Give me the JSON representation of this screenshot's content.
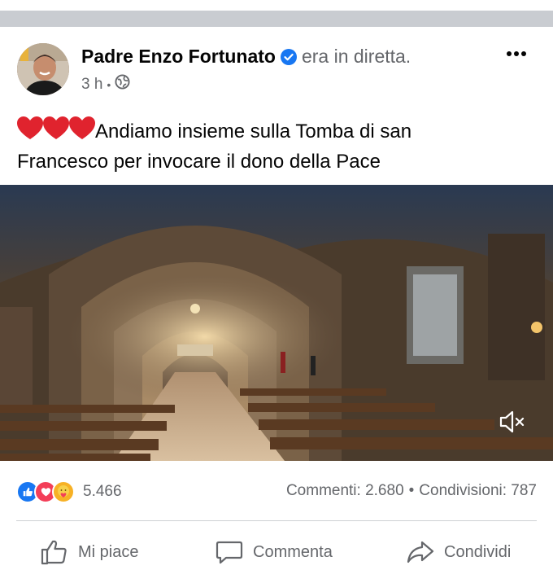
{
  "post": {
    "author_name": "Padre Enzo Fortunato",
    "live_status": "era in diretta.",
    "time_ago": "3 h",
    "meta_dot": "•",
    "text_line1": "Andiamo insieme sulla Tomba di san",
    "text_line2": "Francesco per invocare il dono della Pace",
    "emoji_prefix": "❤❤❤"
  },
  "engagement": {
    "reaction_count": "5.466",
    "comments": "Commenti: 2.680",
    "separator": "•",
    "shares": "Condivisioni: 787"
  },
  "actions": {
    "like": "Mi piace",
    "comment": "Commenta",
    "share": "Condividi"
  },
  "colors": {
    "verified": "#1877f2",
    "like_blue": "#1877f2",
    "love_red": "#f33e58",
    "care_yellow": "#f7b125",
    "secondary_text": "#65676b"
  },
  "icons": [
    "avatar",
    "verified-badge-icon",
    "globe-icon",
    "more-options-icon",
    "heart-emoji",
    "like-reaction-icon",
    "love-reaction-icon",
    "care-reaction-icon",
    "muted-speaker-icon",
    "thumbs-up-icon",
    "comment-bubble-icon",
    "share-arrow-icon"
  ]
}
